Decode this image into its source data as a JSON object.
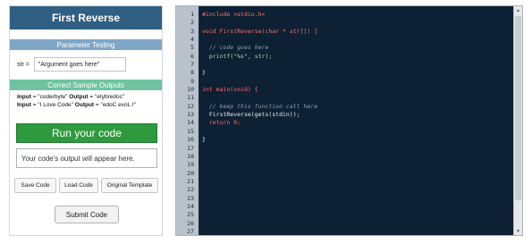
{
  "left": {
    "title": "First Reverse",
    "params_header": "Parameter Testing",
    "param_label": "str =",
    "param_value": "\"Argument goes here\"",
    "samples_header": "Correct Sample Outputs",
    "samples": [
      {
        "in_label": "Input",
        "input": "= \"coderbyte\"",
        "out_label": "Output",
        "output": "= \"etybredoc\""
      },
      {
        "in_label": "Input",
        "input": "= \"I Love Code\"",
        "out_label": "Output",
        "output": "= \"edoC evoL I\""
      }
    ],
    "run_label": "Run your code",
    "output_text": "Your code's output will appear here.",
    "buttons": {
      "save": "Save Code",
      "load": "Load Code",
      "template": "Original Template"
    },
    "submit_label": "Submit Code"
  },
  "editor": {
    "line_count": 27,
    "line_numbers": "1\n2\n3\n4\n5\n6\n7\n8\n9\n10\n11\n12\n13\n14\n15\n16\n17\n18\n19\n20\n21\n22\n23\n24\n25\n26\n27",
    "lines": [
      {
        "t": "#include <stdio.h>",
        "c": "preproc"
      },
      {
        "t": "",
        "c": ""
      },
      {
        "t": "void FirstReverse(char * str[]) {",
        "c": "keyword"
      },
      {
        "t": "",
        "c": ""
      },
      {
        "t": "  // code goes here",
        "c": "comment"
      },
      {
        "t": "  printf(\"%s\", str);",
        "c": "string"
      },
      {
        "t": "",
        "c": ""
      },
      {
        "t": "}",
        "c": ""
      },
      {
        "t": "",
        "c": ""
      },
      {
        "t": "int main(void) {",
        "c": "keyword"
      },
      {
        "t": "",
        "c": ""
      },
      {
        "t": "  // keep this function call here",
        "c": "comment"
      },
      {
        "t": "  FirstReverse(gets(stdin));",
        "c": ""
      },
      {
        "t": "  return 0;",
        "c": "keyword"
      },
      {
        "t": "",
        "c": ""
      },
      {
        "t": "}",
        "c": ""
      }
    ]
  },
  "scroll": {
    "up_icon": "▲",
    "down_icon": "▼"
  }
}
